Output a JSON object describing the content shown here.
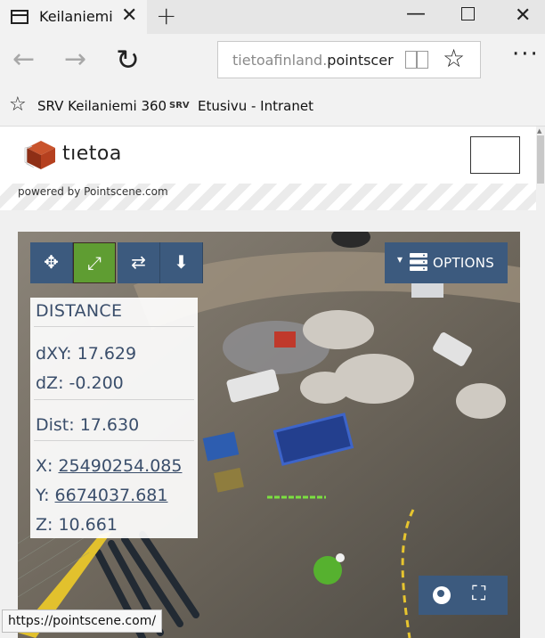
{
  "browser": {
    "tab_title": "Keilaniemi",
    "tab_close": "✕",
    "new_tab": "+",
    "minimize": "—",
    "close": "✕",
    "url_host": "tietoafinland.",
    "url_domain": "pointscer",
    "back": "←",
    "forward": "→",
    "refresh": "↻",
    "favorite_star": "☆",
    "more": "···"
  },
  "favorites": {
    "items": [
      {
        "label": "SRV Keilaniemi 360",
        "icon": "star-outline-icon"
      },
      {
        "label": "Etusivu - Intranet",
        "icon_text": "SRV"
      }
    ]
  },
  "site": {
    "logo_text": "tıetoa",
    "powered_by": "powered by Pointscene.com"
  },
  "viewer": {
    "tools": [
      {
        "name": "move",
        "glyph": "✥",
        "active": false
      },
      {
        "name": "measure-distance",
        "glyph": "⤢",
        "active": true
      },
      {
        "name": "rotate",
        "glyph": "⇄",
        "active": false
      },
      {
        "name": "download",
        "glyph": "⬇",
        "active": false
      }
    ],
    "options_label": "OPTIONS",
    "options_arrow": "▾",
    "fullscreen_glyph": "⛶"
  },
  "measurement": {
    "title": "DISTANCE",
    "dxy": "dXY: 17.629",
    "dz": "dZ: -0.200",
    "dist": "Dist: 17.630",
    "x_label": "X: ",
    "x_value": "25490254.085",
    "y_label": "Y: ",
    "y_value": "6674037.681",
    "z": "Z: 10.661"
  },
  "status_bar": {
    "url": "https://pointscene.com/"
  },
  "colors": {
    "panel_text": "#3a4e6b",
    "tool_blue": "#3c5a7e",
    "tool_active_green": "#5f9d32",
    "logo_red": "#b5401f"
  }
}
